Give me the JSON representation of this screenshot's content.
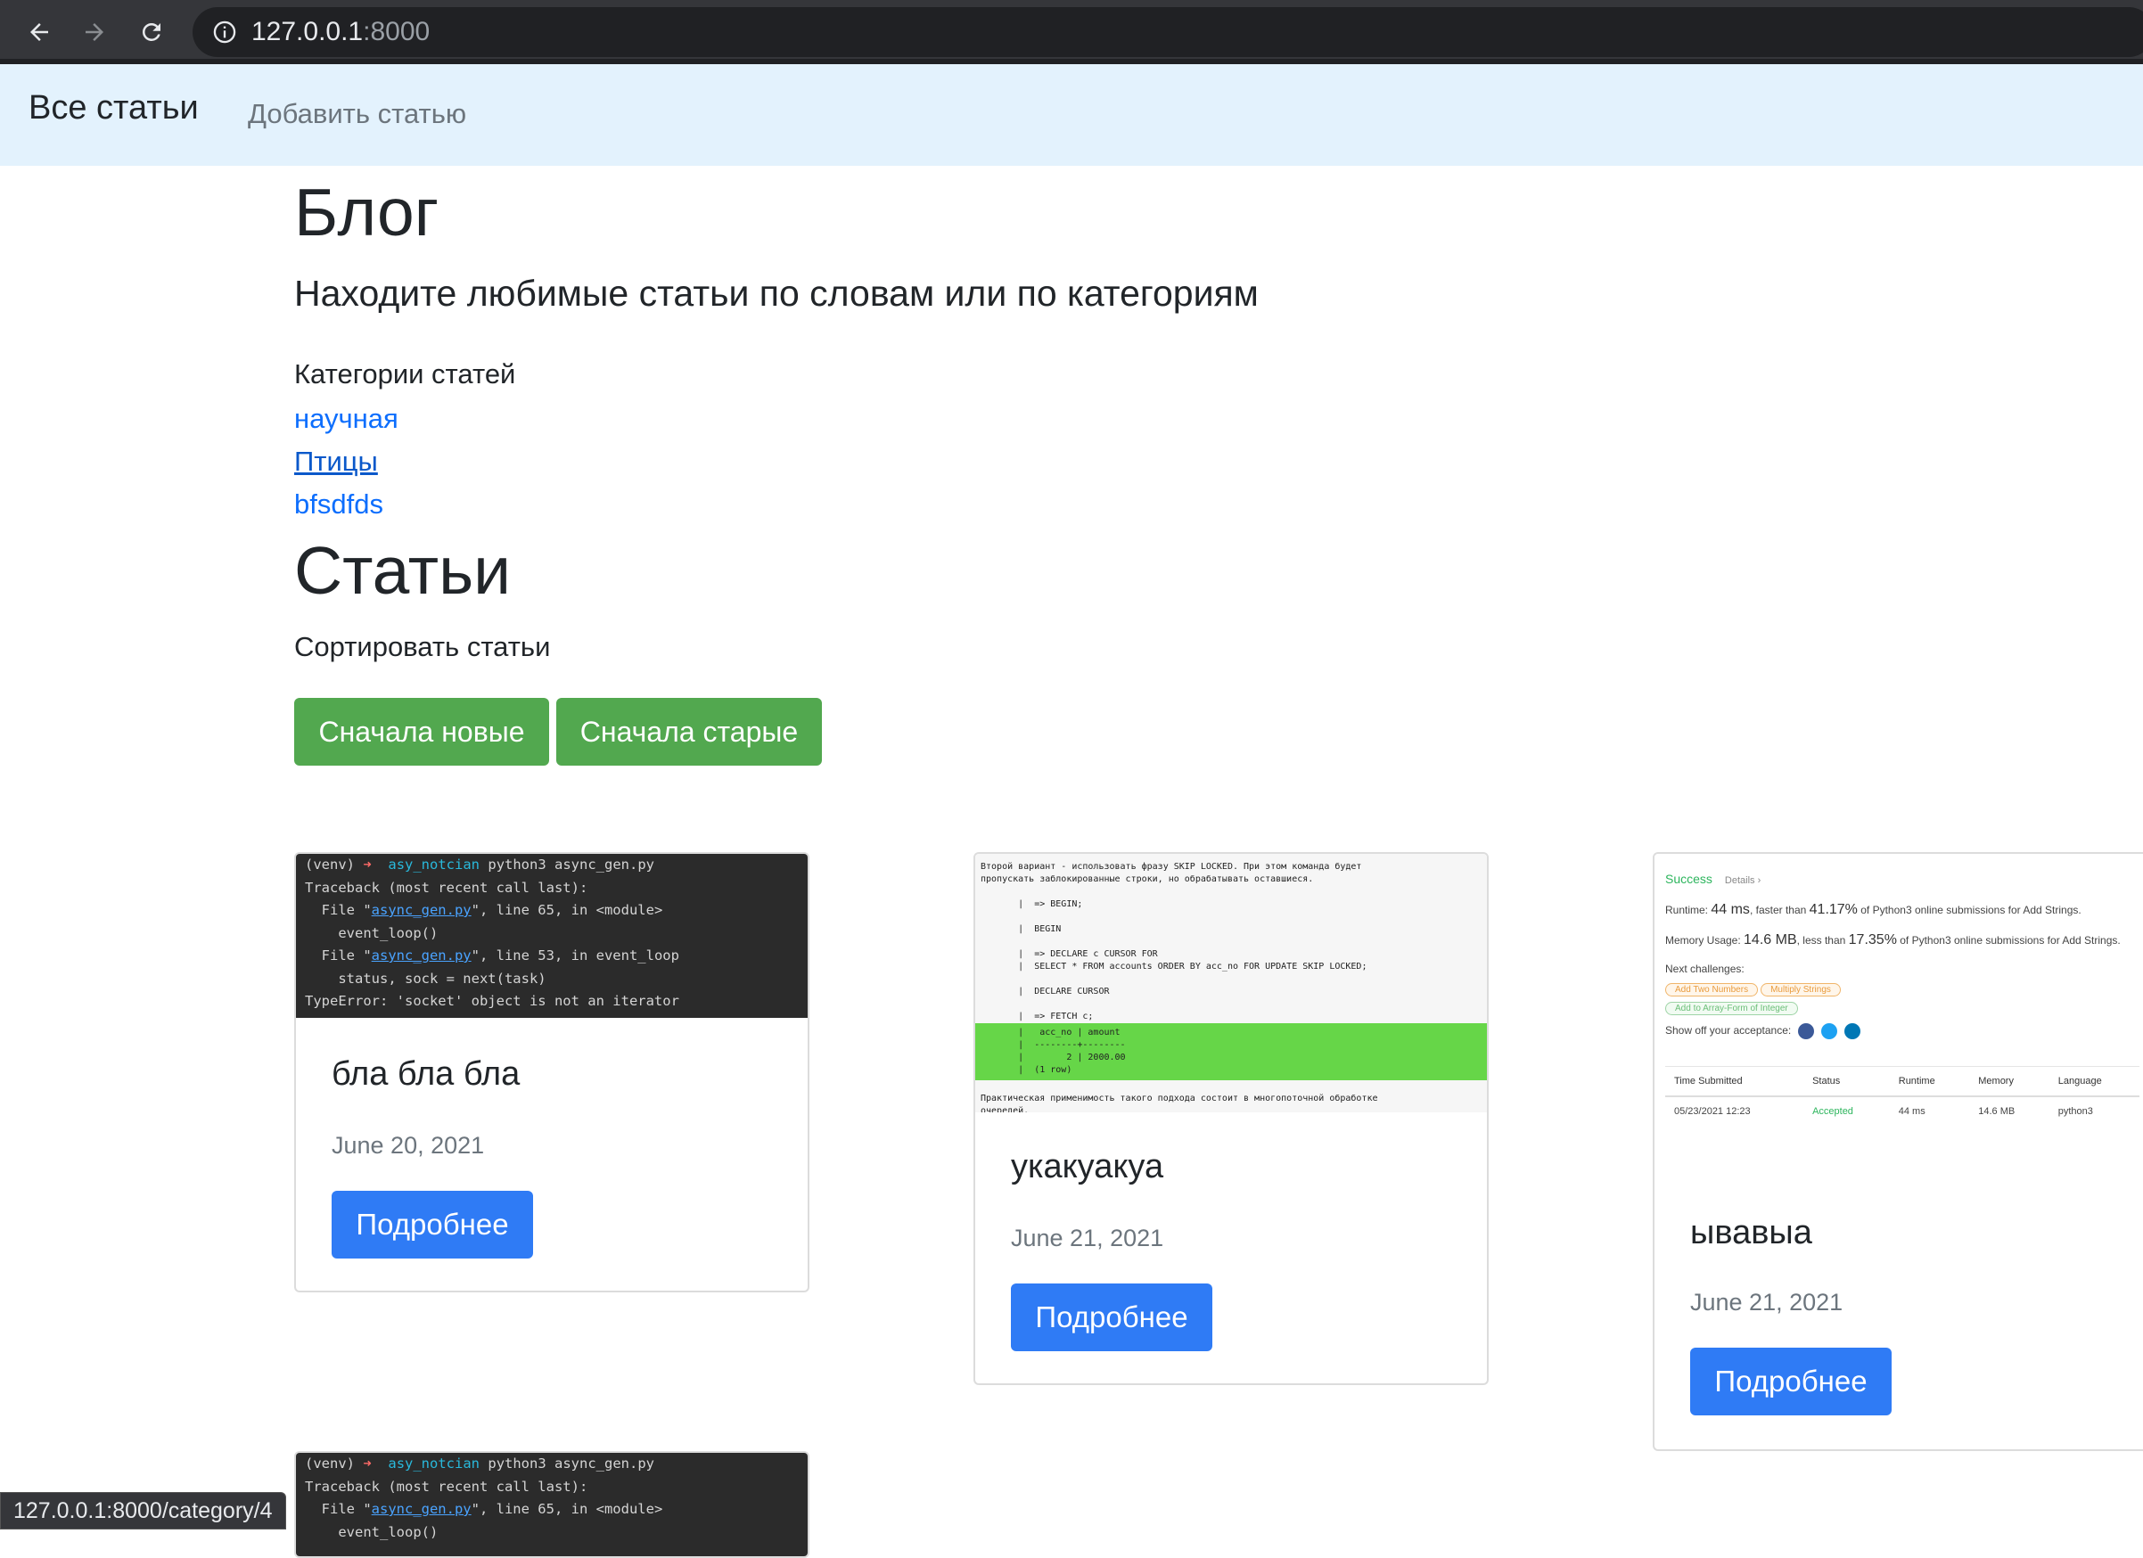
{
  "browser": {
    "url_host": "127.0.0.1",
    "url_port": ":8000",
    "status_url": "127.0.0.1:8000/category/4"
  },
  "navbar": {
    "brand": "Все статьи",
    "add_link": "Добавить статью"
  },
  "page": {
    "title": "Блог",
    "lead": "Находите любимые статьи по словам или по категориям",
    "categories_title": "Категории статей",
    "categories": [
      "научная",
      "Птицы",
      "bfsdfds"
    ],
    "articles_title": "Статьи",
    "sort_title": "Сортировать статьи",
    "sort_new": "Сначала новые",
    "sort_old": "Сначала старые"
  },
  "articles": [
    {
      "title": "бла бла бла",
      "date": "June 20, 2021",
      "button": "Подробнее"
    },
    {
      "title": "укакуакуа",
      "date": "June 21, 2021",
      "button": "Подробнее"
    },
    {
      "title": "ывавыа",
      "date": "June 21, 2021",
      "button": "Подробнее"
    }
  ],
  "terminal": {
    "prompt_venv": "(venv)",
    "prompt_dir": "asy_notcian",
    "command": "python3 async_gen.py",
    "line_traceback": "Traceback (most recent call last):",
    "file1_pre": "  File \"",
    "file_name": "async_gen.py",
    "file1_post": "\", line 65, in <module>",
    "line_event_loop": "    event_loop()",
    "file2_post": "\", line 53, in event_loop",
    "line_status": "    status, sock = next(task)",
    "line_error": "TypeError: 'socket' object is not an iterator"
  },
  "sql_image": {
    "intro": "Второй вариант - использовать фразу SKIP LOCKED. При этом команда будет\nпропускать заблокированные строки, но обрабатывать оставшиеся.",
    "lines": "       |  => BEGIN;\n\n       |  BEGIN\n\n       |  => DECLARE c CURSOR FOR\n       |  SELECT * FROM accounts ORDER BY acc_no FOR UPDATE SKIP LOCKED;\n\n       |  DECLARE CURSOR\n\n       |  => FETCH c;",
    "result": "       |   acc_no | amount\n       |  --------+--------\n       |        2 | 2000.00\n       |  (1 row)",
    "outro": "Практическая применимость такого подхода состоит в многопоточной обработке\nочередей."
  },
  "leetcode_image": {
    "success": "Success",
    "details": "Details ›",
    "runtime_pre": "Runtime: ",
    "runtime_val": "44 ms",
    "runtime_mid": ", faster than ",
    "runtime_pct": "41.17%",
    "runtime_post": " of Python3 online submissions for Add Strings.",
    "mem_pre": "Memory Usage: ",
    "mem_val": "14.6 MB",
    "mem_mid": ", less than ",
    "mem_pct": "17.35%",
    "mem_post": " of Python3 online submissions for Add Strings.",
    "next": "Next challenges:",
    "tag1": "Add Two Numbers",
    "tag2": "Multiply Strings",
    "tag3": "Add to Array-Form of Integer",
    "show_off": "Show off your acceptance:",
    "columns": [
      "Time Submitted",
      "Status",
      "Runtime",
      "Memory",
      "Language"
    ],
    "row": [
      "05/23/2021 12:23",
      "Accepted",
      "44 ms",
      "14.6 MB",
      "python3"
    ],
    "social_colors": [
      "#3b5998",
      "#1da1f2",
      "#0077b5"
    ]
  },
  "colors": {
    "navbar_bg": "#e3f2fd",
    "success_btn": "#52a84f",
    "primary_btn": "#2f7bf5",
    "link": "#0d6efd"
  }
}
